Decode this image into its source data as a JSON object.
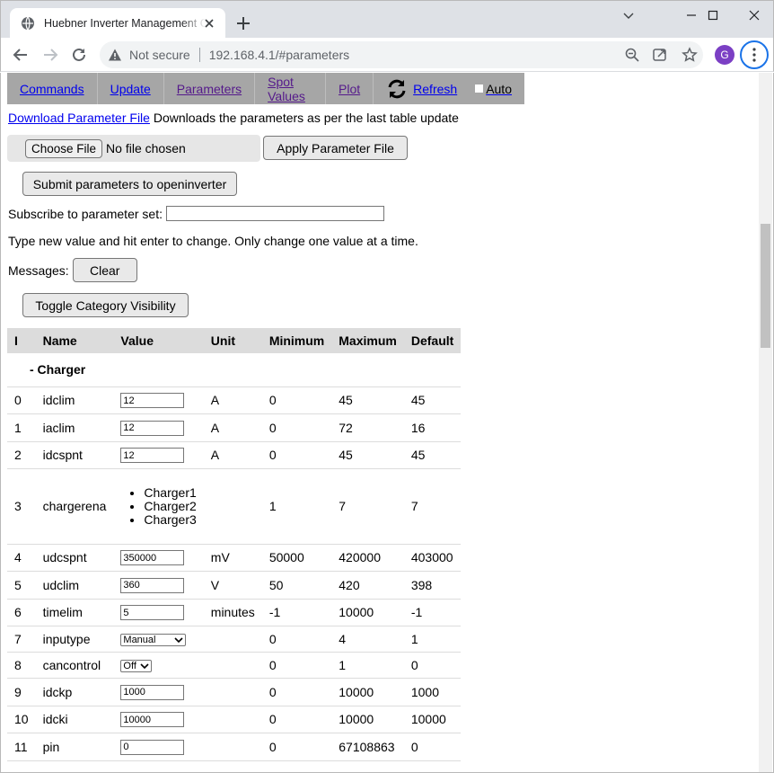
{
  "browser": {
    "tab_title": "Huebner Inverter Management Co",
    "not_secure": "Not secure",
    "url": "192.168.4.1/#parameters",
    "avatar_letter": "G"
  },
  "nav": {
    "items": [
      "Commands",
      "Update",
      "Parameters",
      "Spot Values",
      "Plot"
    ],
    "refresh": "Refresh",
    "auto": "Auto"
  },
  "download": {
    "link": "Download Parameter File",
    "text": " Downloads the parameters as per the last table update"
  },
  "file": {
    "choose": "Choose File",
    "none": "No file chosen",
    "apply": "Apply Parameter File"
  },
  "submit_label": "Submit parameters to openinverter",
  "subscribe_label": "Subscribe to parameter set:",
  "hint": "Type new value and hit enter to change. Only change one value at a time.",
  "messages_label": "Messages:",
  "clear_label": "Clear",
  "toggle_label": "Toggle Category Visibility",
  "table": {
    "headers": [
      "I",
      "Name",
      "Value",
      "Unit",
      "Minimum",
      "Maximum",
      "Default"
    ],
    "category": "- Charger",
    "rows": [
      {
        "i": "0",
        "name": "idclim",
        "value": "12",
        "unit": "A",
        "min": "0",
        "max": "45",
        "def": "45"
      },
      {
        "i": "1",
        "name": "iaclim",
        "value": "12",
        "unit": "A",
        "min": "0",
        "max": "72",
        "def": "16"
      },
      {
        "i": "2",
        "name": "idcspnt",
        "value": "12",
        "unit": "A",
        "min": "0",
        "max": "45",
        "def": "45"
      },
      {
        "i": "3",
        "name": "chargerena",
        "options": [
          "Charger1",
          "Charger2",
          "Charger3"
        ],
        "unit": "",
        "min": "1",
        "max": "7",
        "def": "7"
      },
      {
        "i": "4",
        "name": "udcspnt",
        "value": "350000",
        "unit": "mV",
        "min": "50000",
        "max": "420000",
        "def": "403000"
      },
      {
        "i": "5",
        "name": "udclim",
        "value": "360",
        "unit": "V",
        "min": "50",
        "max": "420",
        "def": "398"
      },
      {
        "i": "6",
        "name": "timelim",
        "value": "5",
        "unit": "minutes",
        "min": "-1",
        "max": "10000",
        "def": "-1"
      },
      {
        "i": "7",
        "name": "inputype",
        "select": "Manual",
        "unit": "",
        "min": "0",
        "max": "4",
        "def": "1"
      },
      {
        "i": "8",
        "name": "cancontrol",
        "select": "Off",
        "unit": "",
        "min": "0",
        "max": "1",
        "def": "0"
      },
      {
        "i": "9",
        "name": "idckp",
        "value": "1000",
        "unit": "",
        "min": "0",
        "max": "10000",
        "def": "1000"
      },
      {
        "i": "10",
        "name": "idcki",
        "value": "10000",
        "unit": "",
        "min": "0",
        "max": "10000",
        "def": "10000"
      },
      {
        "i": "11",
        "name": "pin",
        "value": "0",
        "unit": "",
        "min": "0",
        "max": "67108863",
        "def": "0"
      }
    ]
  }
}
